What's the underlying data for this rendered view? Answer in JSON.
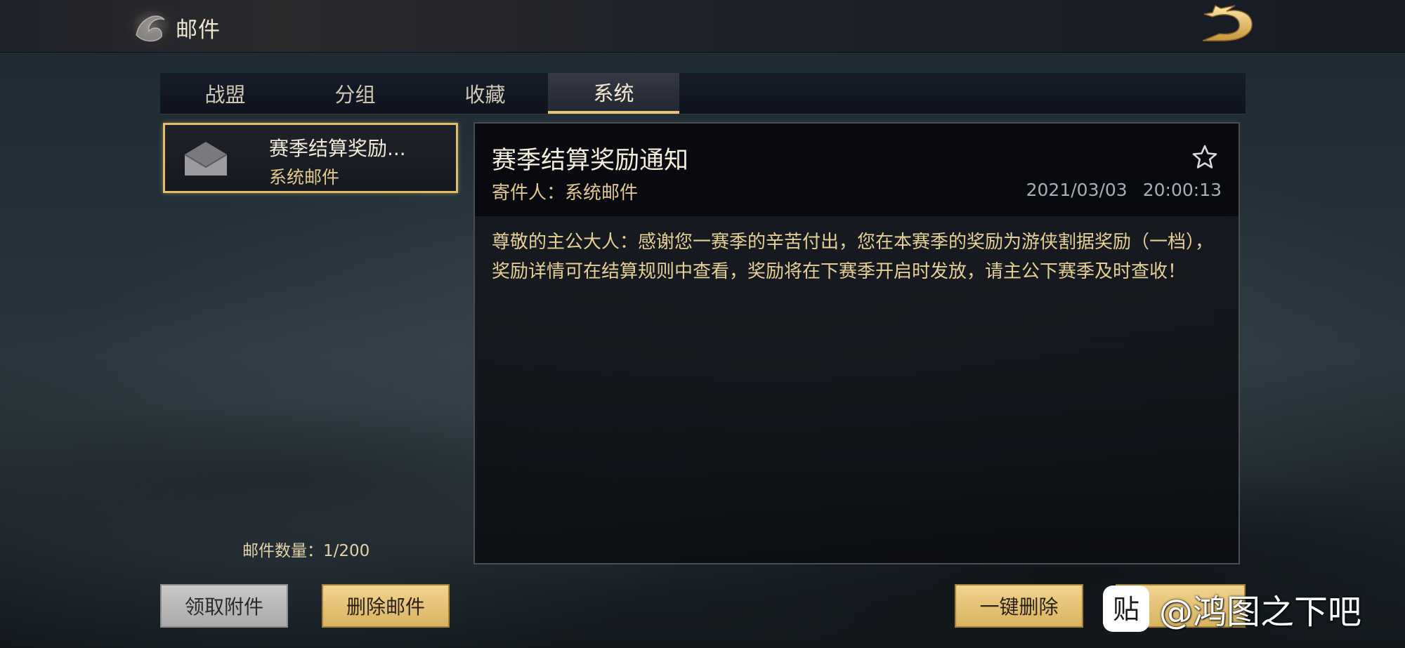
{
  "header": {
    "title": "邮件",
    "emblem_icon": "dragon-emblem-icon",
    "back_icon": "gold-dragon-back-icon"
  },
  "tabs": [
    {
      "label": "战盟",
      "active": false
    },
    {
      "label": "分组",
      "active": false
    },
    {
      "label": "收藏",
      "active": false
    },
    {
      "label": "系统",
      "active": true
    }
  ],
  "mail_list": {
    "items": [
      {
        "title": "赛季结算奖励...",
        "sender": "系统邮件",
        "icon": "opened-envelope-icon",
        "selected": true
      }
    ],
    "count_label": "邮件数量：",
    "count_value": "1/200"
  },
  "detail": {
    "title": "赛季结算奖励通知",
    "sender_label": "寄件人：",
    "sender": "系统邮件",
    "date": "2021/03/03",
    "time": "20:00:13",
    "star_icon": "star-outline-icon",
    "body": "尊敬的主公大人：感谢您一赛季的辛苦付出，您在本赛季的奖励为游侠割据奖励（一档），奖励详情可在结算规则中查看，奖励将在下赛季开启时发放，请主公下赛季及时查收！"
  },
  "buttons": {
    "claim": "领取附件",
    "delete": "删除邮件",
    "delete_all": "一键删除"
  },
  "watermark": {
    "logo_text": "贴",
    "text": "@鸿图之下吧"
  },
  "colors": {
    "accent_gold": "#e2bf66",
    "button_gold": "#d8b362",
    "body_text": "#e6cf95"
  }
}
